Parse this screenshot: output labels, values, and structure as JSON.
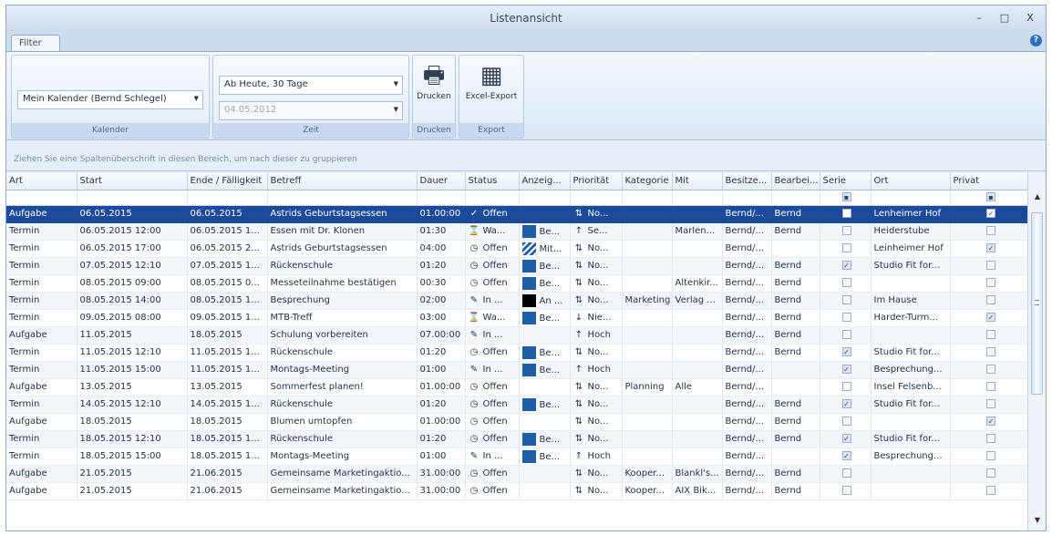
{
  "window": {
    "title": "Listenansicht",
    "min": "–",
    "max": "□",
    "close": "X"
  },
  "tabs": {
    "filter": "Filter",
    "help": "?"
  },
  "ribbon": {
    "kalender": {
      "value": "Mein Kalender (Bernd Schlegel)",
      "label": "Kalender"
    },
    "zeit": {
      "range": "Ab Heute, 30 Tage",
      "date": "04.05.2012",
      "label": "Zeit"
    },
    "drucken": {
      "button": "Drucken",
      "label": "Drucken"
    },
    "export": {
      "button": "Excel-Export",
      "label": "Export"
    }
  },
  "group_hint": "Ziehen Sie eine Spaltenüberschrift in diesen Bereich, um nach dieser zu gruppieren",
  "columns": [
    "Art",
    "Start",
    "Ende / Fälligkeit",
    "Betreff",
    "Dauer",
    "Status",
    "Anzeig...",
    "Priorität",
    "Kategorie",
    "Mit",
    "Besitze...",
    "Bearbei...",
    "Serie",
    "Ort",
    "Privat"
  ],
  "colors": {
    "selection": "#1c4a9b",
    "blue_swatch": "#1f5fa8",
    "black_swatch": "#000000",
    "accent": "#2a6fc2"
  },
  "rows": [
    {
      "art": "Aufgabe",
      "start": "06.05.2015",
      "ende": "06.05.2015",
      "betreff": "Astrids Geburtstagsessen",
      "dauer": "01.00:00",
      "status_icon": "checkmark-icon",
      "status_glyph": "✓",
      "status": "Offen",
      "anzeige_color": "",
      "anzeige": "",
      "prio_glyph": "⇅",
      "prio": "No...",
      "kategorie": "",
      "mit": "",
      "besitzer": "Bernd/...",
      "bearbeiter": "Bernd",
      "serie": false,
      "ort": "Lenheimer Hof",
      "privat": true
    },
    {
      "art": "Termin",
      "start": "06.05.2015 12:00",
      "ende": "06.05.2015 1...",
      "betreff": "Essen mit Dr. Klonen",
      "dauer": "01:30",
      "status_icon": "hourglass-icon",
      "status_glyph": "⌛",
      "status": "Wa...",
      "anzeige_color": "#1f5fa8",
      "anzeige": "Be...",
      "prio_glyph": "↑",
      "prio": "Se...",
      "kategorie": "",
      "mit": "Marlen...",
      "besitzer": "Bernd/...",
      "bearbeiter": "Bernd",
      "serie": false,
      "ort": "Heiderstube",
      "privat": false
    },
    {
      "art": "Termin",
      "start": "06.05.2015 17:00",
      "ende": "06.05.2015 2...",
      "betreff": "Astrids Geburtstagsessen",
      "dauer": "04:00",
      "status_icon": "clock-icon",
      "status_glyph": "◷",
      "status": "Offen",
      "anzeige_color": "hatch",
      "anzeige": "Mit...",
      "prio_glyph": "⇅",
      "prio": "No...",
      "kategorie": "",
      "mit": "",
      "besitzer": "Bernd/...",
      "bearbeiter": "",
      "serie": false,
      "ort": "Leinheimer Hof",
      "privat": true
    },
    {
      "art": "Termin",
      "start": "07.05.2015 12:10",
      "ende": "07.05.2015 1...",
      "betreff": "Rückenschule",
      "dauer": "01:20",
      "status_icon": "clock-icon",
      "status_glyph": "◷",
      "status": "Offen",
      "anzeige_color": "#1f5fa8",
      "anzeige": "Be...",
      "prio_glyph": "⇅",
      "prio": "No...",
      "kategorie": "",
      "mit": "",
      "besitzer": "Bernd/...",
      "bearbeiter": "Bernd",
      "serie": true,
      "ort": "Studio Fit for...",
      "privat": false
    },
    {
      "art": "Termin",
      "start": "08.05.2015 09:00",
      "ende": "08.05.2015 0...",
      "betreff": "Messeteilnahme bestätigen",
      "dauer": "00:30",
      "status_icon": "clock-icon",
      "status_glyph": "◷",
      "status": "Offen",
      "anzeige_color": "#1f5fa8",
      "anzeige": "Be...",
      "prio_glyph": "⇅",
      "prio": "No...",
      "kategorie": "",
      "mit": "Altenkir...",
      "besitzer": "Bernd/...",
      "bearbeiter": "Bernd",
      "serie": false,
      "ort": "",
      "privat": false
    },
    {
      "art": "Termin",
      "start": "08.05.2015 14:00",
      "ende": "08.05.2015 1...",
      "betreff": "Besprechung",
      "dauer": "02:00",
      "status_icon": "pencil-icon",
      "status_glyph": "✎",
      "status": "In ...",
      "anzeige_color": "#000000",
      "anzeige": "An ...",
      "prio_glyph": "⇅",
      "prio": "No...",
      "kategorie": "Marketing",
      "mit": "Verlag ...",
      "besitzer": "Bernd/...",
      "bearbeiter": "Bernd",
      "serie": false,
      "ort": "Im Hause",
      "privat": false
    },
    {
      "art": "Termin",
      "start": "09.05.2015 08:00",
      "ende": "09.05.2015 1...",
      "betreff": "MTB-Treff",
      "dauer": "03:00",
      "status_icon": "hourglass-icon",
      "status_glyph": "⌛",
      "status": "Wa...",
      "anzeige_color": "#1f5fa8",
      "anzeige": "Be...",
      "prio_glyph": "↓",
      "prio": "Nie...",
      "kategorie": "",
      "mit": "",
      "besitzer": "Bernd/...",
      "bearbeiter": "Bernd",
      "serie": false,
      "ort": "Harder-Turm...",
      "privat": true
    },
    {
      "art": "Aufgabe",
      "start": "11.05.2015",
      "ende": "18.05.2015",
      "betreff": "Schulung vorbereiten",
      "dauer": "07.00:00",
      "status_icon": "pencil-icon",
      "status_glyph": "✎",
      "status": "In ...",
      "anzeige_color": "",
      "anzeige": "",
      "prio_glyph": "↑",
      "prio": "Hoch",
      "kategorie": "",
      "mit": "",
      "besitzer": "Bernd/...",
      "bearbeiter": "Bernd",
      "serie": false,
      "ort": "",
      "privat": false
    },
    {
      "art": "Termin",
      "start": "11.05.2015 12:10",
      "ende": "11.05.2015 1...",
      "betreff": "Rückenschule",
      "dauer": "01:20",
      "status_icon": "clock-icon",
      "status_glyph": "◷",
      "status": "Offen",
      "anzeige_color": "#1f5fa8",
      "anzeige": "Be...",
      "prio_glyph": "⇅",
      "prio": "No...",
      "kategorie": "",
      "mit": "",
      "besitzer": "Bernd/...",
      "bearbeiter": "Bernd",
      "serie": true,
      "ort": "Studio Fit for...",
      "privat": false
    },
    {
      "art": "Termin",
      "start": "11.05.2015 15:00",
      "ende": "11.05.2015 1...",
      "betreff": "Montags-Meeting",
      "dauer": "01:00",
      "status_icon": "pencil-icon",
      "status_glyph": "✎",
      "status": "In ...",
      "anzeige_color": "#1f5fa8",
      "anzeige": "Be...",
      "prio_glyph": "↑",
      "prio": "Hoch",
      "kategorie": "",
      "mit": "",
      "besitzer": "Bernd/...",
      "bearbeiter": "",
      "serie": true,
      "ort": "Besprechung...",
      "privat": false
    },
    {
      "art": "Aufgabe",
      "start": "13.05.2015",
      "ende": "13.05.2015",
      "betreff": "Sommerfest planen!",
      "dauer": "01.00:00",
      "status_icon": "clock-icon",
      "status_glyph": "◷",
      "status": "Offen",
      "anzeige_color": "",
      "anzeige": "",
      "prio_glyph": "⇅",
      "prio": "No...",
      "kategorie": "Planning",
      "mit": "Alle",
      "besitzer": "Bernd/...",
      "bearbeiter": "",
      "serie": false,
      "ort": "Insel Felsenb...",
      "privat": false
    },
    {
      "art": "Termin",
      "start": "14.05.2015 12:10",
      "ende": "14.05.2015 1...",
      "betreff": "Rückenschule",
      "dauer": "01:20",
      "status_icon": "clock-icon",
      "status_glyph": "◷",
      "status": "Offen",
      "anzeige_color": "#1f5fa8",
      "anzeige": "Be...",
      "prio_glyph": "⇅",
      "prio": "No...",
      "kategorie": "",
      "mit": "",
      "besitzer": "Bernd/...",
      "bearbeiter": "Bernd",
      "serie": true,
      "ort": "Studio Fit for...",
      "privat": false
    },
    {
      "art": "Aufgabe",
      "start": "18.05.2015",
      "ende": "18.05.2015",
      "betreff": "Blumen umtopfen",
      "dauer": "01.00:00",
      "status_icon": "clock-icon",
      "status_glyph": "◷",
      "status": "Offen",
      "anzeige_color": "",
      "anzeige": "",
      "prio_glyph": "⇅",
      "prio": "No...",
      "kategorie": "",
      "mit": "",
      "besitzer": "Bernd/...",
      "bearbeiter": "Bernd",
      "serie": false,
      "ort": "",
      "privat": true
    },
    {
      "art": "Termin",
      "start": "18.05.2015 12:10",
      "ende": "18.05.2015 1...",
      "betreff": "Rückenschule",
      "dauer": "01:20",
      "status_icon": "clock-icon",
      "status_glyph": "◷",
      "status": "Offen",
      "anzeige_color": "#1f5fa8",
      "anzeige": "Be...",
      "prio_glyph": "⇅",
      "prio": "No...",
      "kategorie": "",
      "mit": "",
      "besitzer": "Bernd/...",
      "bearbeiter": "Bernd",
      "serie": true,
      "ort": "Studio Fit for...",
      "privat": false
    },
    {
      "art": "Termin",
      "start": "18.05.2015 15:00",
      "ende": "18.05.2015 1...",
      "betreff": "Montags-Meeting",
      "dauer": "01:00",
      "status_icon": "pencil-icon",
      "status_glyph": "✎",
      "status": "In ...",
      "anzeige_color": "#1f5fa8",
      "anzeige": "Be...",
      "prio_glyph": "↑",
      "prio": "Hoch",
      "kategorie": "",
      "mit": "",
      "besitzer": "Bernd/...",
      "bearbeiter": "",
      "serie": true,
      "ort": "Besprechung...",
      "privat": false
    },
    {
      "art": "Aufgabe",
      "start": "21.05.2015",
      "ende": "21.06.2015",
      "betreff": "Gemeinsame Marketingaktio...",
      "dauer": "31.00:00",
      "status_icon": "clock-icon",
      "status_glyph": "◷",
      "status": "Offen",
      "anzeige_color": "",
      "anzeige": "",
      "prio_glyph": "⇅",
      "prio": "No...",
      "kategorie": "Kooper...",
      "mit": "Blankl's...",
      "besitzer": "Bernd/...",
      "bearbeiter": "Bernd",
      "serie": false,
      "ort": "",
      "privat": false
    },
    {
      "art": "Aufgabe",
      "start": "21.05.2015",
      "ende": "21.06.2015",
      "betreff": "Gemeinsame Marketingaktio...",
      "dauer": "31.00:00",
      "status_icon": "clock-icon",
      "status_glyph": "◷",
      "status": "Offen",
      "anzeige_color": "",
      "anzeige": "",
      "prio_glyph": "⇅",
      "prio": "No...",
      "kategorie": "Kooper...",
      "mit": "AIX Bik...",
      "besitzer": "Bernd/...",
      "bearbeiter": "Bernd",
      "serie": false,
      "ort": "",
      "privat": false
    }
  ],
  "selected_row": 0
}
